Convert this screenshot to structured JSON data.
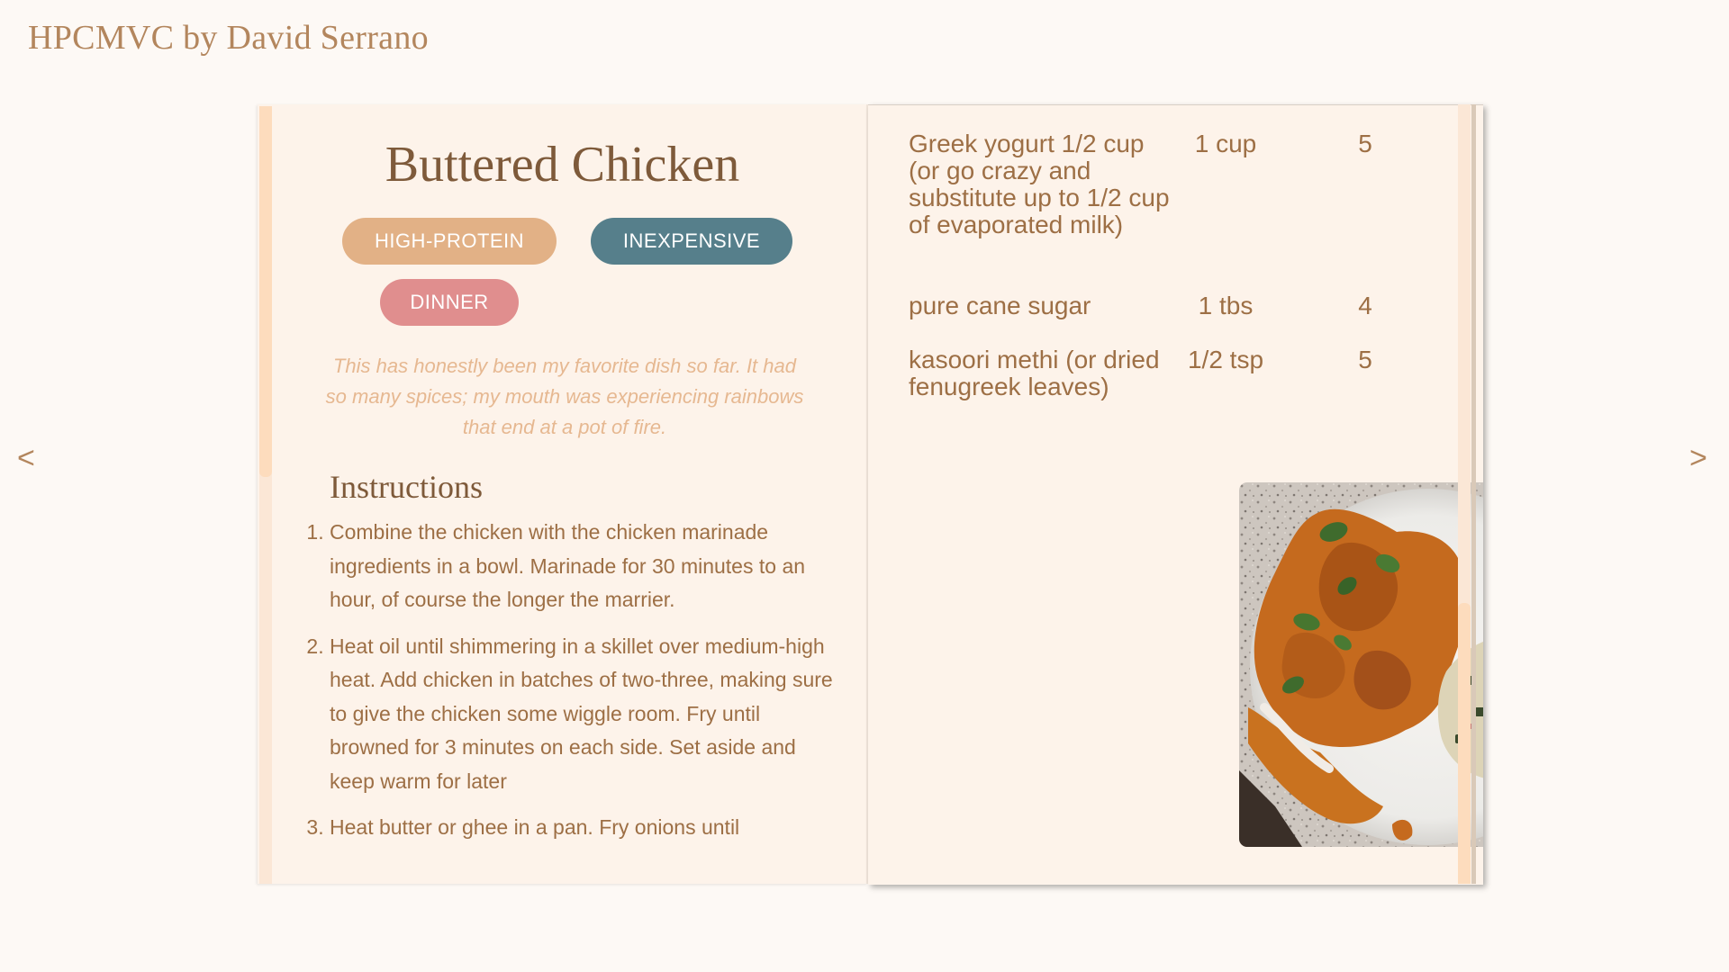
{
  "site": {
    "title": "HPCMVC by David Serrano"
  },
  "nav": {
    "prev": "<",
    "next": ">"
  },
  "recipe": {
    "title": "Buttered Chicken",
    "tags": [
      {
        "label": "HIGH-PROTEIN",
        "color": "#e2b186"
      },
      {
        "label": "INEXPENSIVE",
        "color": "#567f8b"
      },
      {
        "label": "DINNER",
        "color": "#e08e8e"
      }
    ],
    "description": "This has honestly been my favorite dish so far. It had so many spices; my mouth was experiencing rainbows that end at a pot of fire.",
    "instructions_heading": "Instructions",
    "instructions": [
      "Combine the chicken with the chicken marinade ingredients in a bowl. Marinade for 30 minutes to an hour, of course the longer the marrier.",
      "Heat oil until shimmering in a skillet over medium-high heat. Add chicken in batches of two-three, making sure to give the chicken some wiggle room. Fry until browned for 3 minutes on each side. Set aside and keep warm for later",
      "Heat butter or ghee in a pan. Fry onions until"
    ],
    "ingredients": [
      {
        "name": "Greek yogurt 1/2 cup (or go crazy and substitute up to 1/2 cup of evaporated milk)",
        "amount": "1 cup",
        "rating": "5"
      },
      {
        "name": "pure cane sugar",
        "amount": "1 tbs",
        "rating": "4"
      },
      {
        "name": "kasoori methi (or dried fenugreek leaves)",
        "amount": "1/2 tsp",
        "rating": "5"
      }
    ],
    "photo": {
      "icon": "food-photo"
    }
  },
  "colors": {
    "background": "#fdf9f5",
    "page": "#fdf3ea",
    "accent_brown": "#7e5a3a",
    "text_brown": "#9d6f45",
    "description": "#e6b891"
  }
}
